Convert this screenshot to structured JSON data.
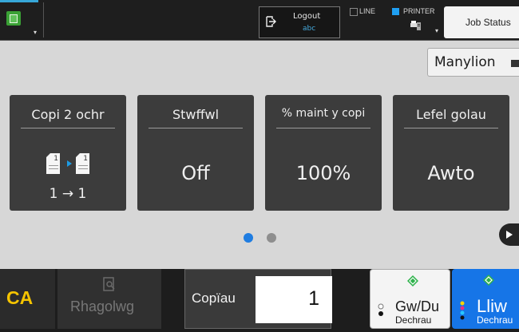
{
  "topbar": {
    "logout": {
      "label": "Logout",
      "user": "abc"
    },
    "line_label": "LINE",
    "printer_label": "PRINTER",
    "job_status_label": "Job Status"
  },
  "main": {
    "manual_button_label": "Manylion",
    "tiles": [
      {
        "title": "Copi 2 ochr",
        "mini_text": "1 → 1",
        "doc_left": "1",
        "doc_right": "1"
      },
      {
        "title": "Stwffwl",
        "value": "Off"
      },
      {
        "title": "% maint y copi",
        "value": "100%"
      },
      {
        "title": "Lefel golau",
        "value": "Awto"
      }
    ],
    "page_indicator": {
      "current": 1,
      "total": 2
    }
  },
  "bottombar": {
    "ca_label": "CA",
    "preview_label": "Rhagolwg",
    "copies_label": "Copïau",
    "copies_value": "1",
    "bw_start": {
      "label": "Gw/Du",
      "sub": "Dechrau"
    },
    "color_start": {
      "label": "Lliw",
      "sub": "Dechrau"
    }
  },
  "colors": {
    "accent": "#1675e7",
    "ca_yellow": "#f5c400",
    "tile_bg": "#3c3c3c",
    "start_green": "#2fb24c"
  },
  "icons": {
    "home": "home-copy-icon",
    "logout": "logout-icon",
    "printer": "printer-icon",
    "manual": "arrow-right-icon",
    "preview": "preview-icon",
    "next": "play-next-icon",
    "start": "start-diamond-icon"
  }
}
